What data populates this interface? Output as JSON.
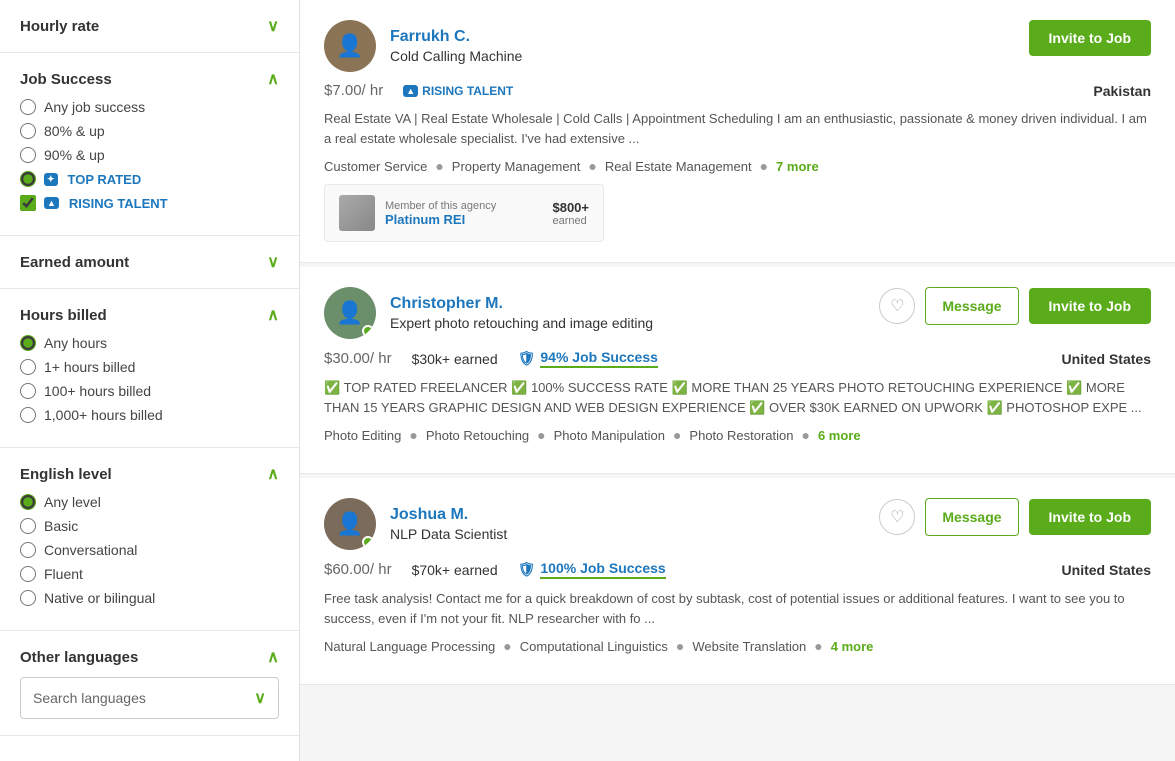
{
  "sidebar": {
    "sections": [
      {
        "id": "hourly-rate",
        "title": "Hourly rate",
        "expanded": false,
        "chevron": "∨"
      },
      {
        "id": "job-success",
        "title": "Job Success",
        "expanded": true,
        "chevron": "∧",
        "options": [
          {
            "id": "any",
            "label": "Any job success",
            "type": "radio",
            "checked": false
          },
          {
            "id": "80up",
            "label": "80% & up",
            "type": "radio",
            "checked": false
          },
          {
            "id": "90up",
            "label": "90% & up",
            "type": "radio",
            "checked": false
          },
          {
            "id": "top-rated",
            "label": "TOP RATED",
            "type": "radio",
            "checked": true,
            "badge": true
          },
          {
            "id": "rising-talent",
            "label": "RISING TALENT",
            "type": "checkbox",
            "checked": true,
            "badge": true
          }
        ]
      },
      {
        "id": "earned-amount",
        "title": "Earned amount",
        "expanded": false,
        "chevron": "∨"
      },
      {
        "id": "hours-billed",
        "title": "Hours billed",
        "expanded": true,
        "chevron": "∧",
        "options": [
          {
            "id": "any-hours",
            "label": "Any hours",
            "type": "radio",
            "checked": true
          },
          {
            "id": "1plus",
            "label": "1+ hours billed",
            "type": "radio",
            "checked": false
          },
          {
            "id": "100plus",
            "label": "100+ hours billed",
            "type": "radio",
            "checked": false
          },
          {
            "id": "1000plus",
            "label": "1,000+ hours billed",
            "type": "radio",
            "checked": false
          }
        ]
      },
      {
        "id": "english-level",
        "title": "English level",
        "expanded": true,
        "chevron": "∧",
        "options": [
          {
            "id": "any-level",
            "label": "Any level",
            "type": "radio",
            "checked": true
          },
          {
            "id": "basic",
            "label": "Basic",
            "type": "radio",
            "checked": false
          },
          {
            "id": "conversational",
            "label": "Conversational",
            "type": "radio",
            "checked": false
          },
          {
            "id": "fluent",
            "label": "Fluent",
            "type": "radio",
            "checked": false
          },
          {
            "id": "native",
            "label": "Native or bilingual",
            "type": "radio",
            "checked": false
          }
        ]
      },
      {
        "id": "other-languages",
        "title": "Other languages",
        "expanded": true,
        "chevron": "∧",
        "search_placeholder": "Search languages"
      }
    ]
  },
  "freelancers": [
    {
      "id": "farrukh",
      "name": "Farrukh C.",
      "title": "Cold Calling Machine",
      "rate": "$7.00",
      "rate_unit": "/ hr",
      "earned": null,
      "job_success": null,
      "location": "Pakistan",
      "badge": "RISING TALENT",
      "online": false,
      "description": "Real Estate VA | Real Estate Wholesale | Cold Calls | Appointment Scheduling I am an enthusiastic, passionate & money driven individual. I am a real estate wholesale specialist. I've had extensive ...",
      "skills": [
        "Customer Service",
        "Property Management",
        "Real Estate Management"
      ],
      "more_skills": "7 more",
      "has_agency": true,
      "agency": {
        "label": "Member of this agency",
        "name": "Platinum REI",
        "earned": "$800+",
        "earned_label": "earned"
      },
      "show_message": false,
      "invite_label": "Invite to Job"
    },
    {
      "id": "christopher",
      "name": "Christopher M.",
      "title": "Expert photo retouching and image editing",
      "rate": "$30.00",
      "rate_unit": "/ hr",
      "earned": "$30k+",
      "earned_label": "earned",
      "job_success": "94% Job Success",
      "location": "United States",
      "badge": null,
      "online": true,
      "description": "✅ TOP RATED FREELANCER ✅ 100% SUCCESS RATE ✅ MORE THAN 25 YEARS PHOTO RETOUCHING EXPERIENCE ✅ MORE THAN 15 YEARS GRAPHIC DESIGN AND WEB DESIGN EXPERIENCE ✅ OVER $30K EARNED ON UPWORK ✅ PHOTOSHOP EXPE ...",
      "skills": [
        "Photo Editing",
        "Photo Retouching",
        "Photo Manipulation",
        "Photo Restoration"
      ],
      "more_skills": "6 more",
      "has_agency": false,
      "show_message": true,
      "invite_label": "Invite to Job",
      "message_label": "Message"
    },
    {
      "id": "joshua",
      "name": "Joshua M.",
      "title": "NLP Data Scientist",
      "rate": "$60.00",
      "rate_unit": "/ hr",
      "earned": "$70k+",
      "earned_label": "earned",
      "job_success": "100% Job Success",
      "location": "United States",
      "badge": null,
      "online": true,
      "description": "Free task analysis! Contact me for a quick breakdown of cost by subtask, cost of potential issues or additional features. I want to see you to success, even if I'm not your fit. NLP researcher with fo ...",
      "skills": [
        "Natural Language Processing",
        "Computational Linguistics",
        "Website Translation"
      ],
      "more_skills": "4 more",
      "has_agency": false,
      "show_message": true,
      "invite_label": "Invite to Job",
      "message_label": "Message"
    }
  ],
  "icons": {
    "chevron_down": "∨",
    "chevron_up": "∧",
    "heart": "♡",
    "shield": "🛡"
  }
}
